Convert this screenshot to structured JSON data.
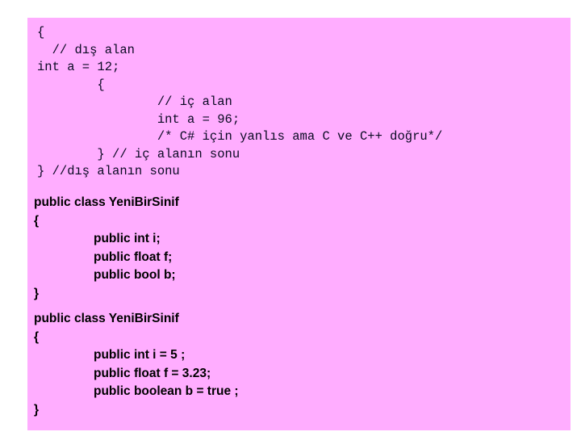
{
  "slide": {
    "panel_background": "#ffadff",
    "page_background": "#ffffff",
    "code_text_color": "#0a0a23",
    "class_text_color": "#000000"
  },
  "code_block": {
    "name": "scope-example-code",
    "lines": [
      "{",
      "  // dış alan",
      "int a = 12;",
      "        {",
      "                // iç alan",
      "                int a = 96;",
      "                /* C# için yanlıs ama C ve C++ doğru*/",
      "        } // iç alanın sonu",
      "} //dış alanın sonu"
    ]
  },
  "class_block_1": {
    "name": "class-declaration-fields",
    "header": "public class YeniBirSinif",
    "open_brace": "{",
    "members": [
      "public int i;",
      "public float f;",
      "public bool b;"
    ],
    "close_brace": "}"
  },
  "class_block_2": {
    "name": "class-declaration-initialized-fields",
    "header": "public class YeniBirSinif",
    "open_brace": "{",
    "members": [
      "public int i = 5 ;",
      "public float f = 3.23;",
      "public boolean b = true ;"
    ],
    "close_brace": "}"
  }
}
